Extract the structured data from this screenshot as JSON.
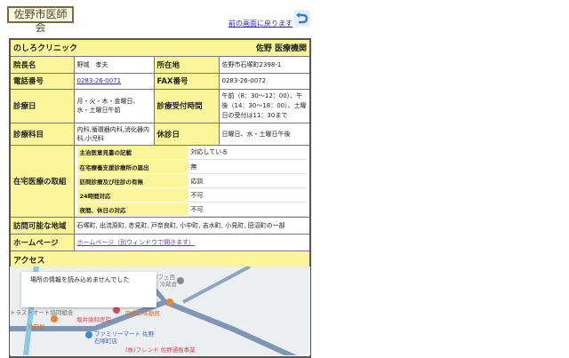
{
  "header": {
    "logo": "佐野市医師会",
    "back_link": "前の画面に戻ります"
  },
  "clinic": {
    "name": "のしろクリニック",
    "area": "佐野 医療機関",
    "rows": [
      {
        "l1": "院長名",
        "v1": "野城　孝夫",
        "l2": "所在地",
        "v2": "佐野市石塚町2398-1"
      },
      {
        "l1": "電話番号",
        "v1": "0283-26-0071",
        "l2": "FAX番号",
        "v2": "0283-26-0072"
      },
      {
        "l1": "診療日",
        "v1": "月・火・木・金曜日、水・土曜日午前",
        "l2": "診療受付時間",
        "v2": "午前（8：30〜12：00）、午後（14：30〜18：00）、土曜日の受付は11：30まで"
      },
      {
        "l1": "診療科目",
        "v1": "内科,循環器内科,消化器内科,小児科",
        "l2": "休診日",
        "v2": "日曜日、水・土曜日午後"
      }
    ],
    "home_care": {
      "label": "在宅医療の取組",
      "items": [
        {
          "k": "主治医意見書の記載",
          "v": "対応している"
        },
        {
          "k": "在宅療養支援診療所の届出",
          "v": "無"
        },
        {
          "k": "訪問診療及び往診の有無",
          "v": "応談"
        },
        {
          "k": "24時間対応",
          "v": "不可"
        },
        {
          "k": "夜間、休日の対応",
          "v": "不可"
        }
      ]
    },
    "visit_area": {
      "label": "訪問可能な地域",
      "value": "石塚町, 出流原町, 赤見町, 戸奈良町, 小中町, 吉水町, 小見町, 田沼町の一部"
    },
    "homepage": {
      "label": "ホームページ",
      "link": "ホームページ（別ウィンドウで開きます）"
    },
    "access": {
      "label": "アクセス"
    }
  },
  "map": {
    "error": "場所の情報を読み込めませんでした",
    "labels": [
      "トラストオート協同組合",
      "四季の味動館",
      "カフェ西茶 冷蔵倉庫",
      "堀井歯科医院",
      "池田屋",
      "ファミリーマート 佐野石塚町店",
      "(株)フレンド 佐野通販事業"
    ]
  }
}
